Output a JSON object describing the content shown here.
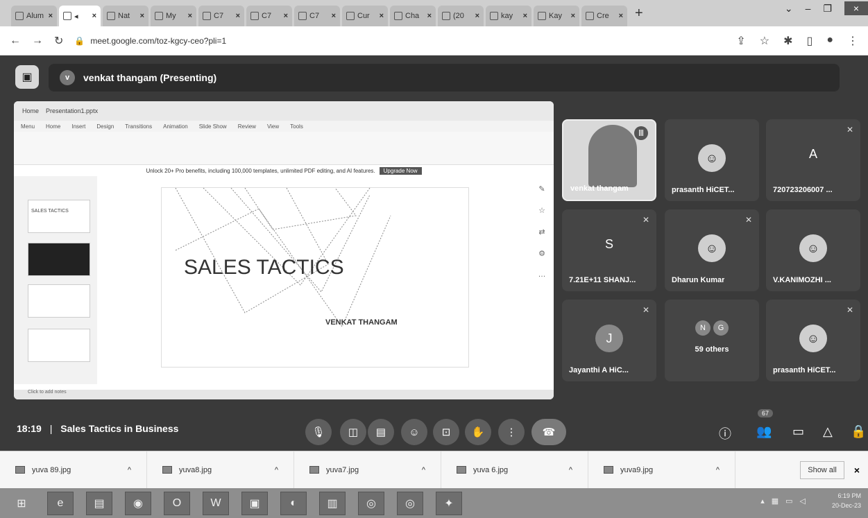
{
  "browser": {
    "tabs": [
      {
        "label": "Alum"
      },
      {
        "label": "",
        "active": true
      },
      {
        "label": "Nat"
      },
      {
        "label": "My"
      },
      {
        "label": "C7"
      },
      {
        "label": "C7"
      },
      {
        "label": "C7"
      },
      {
        "label": "Cur"
      },
      {
        "label": "Cha"
      },
      {
        "label": "(20"
      },
      {
        "label": "kay"
      },
      {
        "label": "Kay"
      },
      {
        "label": "Cre"
      }
    ],
    "url": "meet.google.com/toz-kgcy-ceo?pli=1"
  },
  "meet": {
    "presenter": "venkat thangam (Presenting)",
    "presenter_initial": "v",
    "meeting_time": "18:19",
    "separator": "|",
    "meeting_title": "Sales Tactics in Business",
    "participants_count": "67",
    "tiles": [
      {
        "name": "venkat thangam",
        "type": "video"
      },
      {
        "name": "prasanth HiCET...",
        "type": "avatar"
      },
      {
        "name": "720723206007 ...",
        "type": "letter",
        "letter": "A"
      },
      {
        "name": "7.21E+11 SHANJ...",
        "type": "letter",
        "letter": "S"
      },
      {
        "name": "Dharun Kumar",
        "type": "avatar"
      },
      {
        "name": "V.KANIMOZHI ...",
        "type": "avatar"
      },
      {
        "name": "Jayanthi A HiC...",
        "type": "letter",
        "letter": "J"
      },
      {
        "name": "59 others",
        "type": "others",
        "letters": [
          "N",
          "G"
        ]
      },
      {
        "name": "prasanth HiCET...",
        "type": "avatar"
      }
    ]
  },
  "slide": {
    "title": "SALES TACTICS",
    "subtitle": "VENKAT THANGAM",
    "thumb1_text": "SALES TACTICS",
    "app_tab": "Presentation1.pptx",
    "menu_items": [
      "Menu",
      "Home",
      "Insert",
      "Design",
      "Transitions",
      "Animation",
      "Slide Show",
      "Review",
      "View",
      "Tools"
    ],
    "banner_text": "Unlock 20+ Pro benefits, including 100,000 templates, unlimited PDF editing, and AI features.",
    "banner_button": "Upgrade Now",
    "status_text": "Click to add notes"
  },
  "downloads": {
    "items": [
      "yuva 89.jpg",
      "yuva8.jpg",
      "yuva7.jpg",
      "yuva 6.jpg",
      "yuva9.jpg"
    ],
    "show_all": "Show all"
  },
  "taskbar": {
    "time": "6:19 PM",
    "date": "20-Dec-23"
  }
}
